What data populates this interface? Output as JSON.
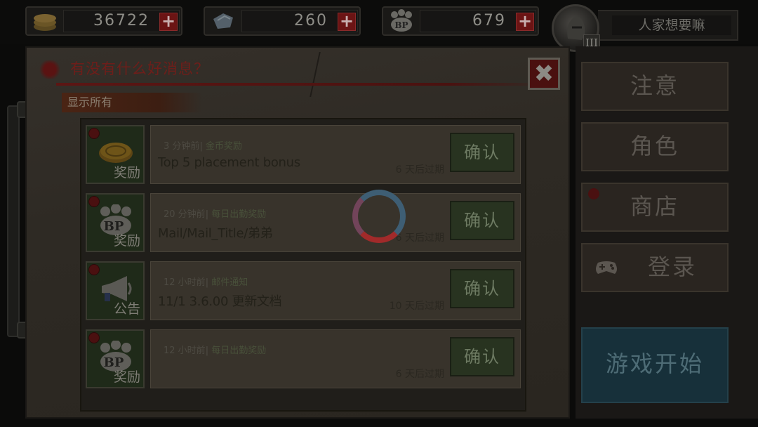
{
  "currency": [
    {
      "icon": "gold-coin-icon",
      "value": "36722"
    },
    {
      "icon": "diamond-icon",
      "value": "260"
    },
    {
      "icon": "bp-paw-icon",
      "value": "679"
    }
  ],
  "player": {
    "rank": "III",
    "nickname": "人家想要嘛"
  },
  "panel": {
    "title": "有没有什么好消息？",
    "filter_label": "显示所有",
    "close_icon": "✖"
  },
  "messages": [
    {
      "time": "3 分钟前",
      "type": "金币奖励",
      "subject": "Top 5 placement bonus",
      "expire": "6 天后过期",
      "tag": "奖励",
      "icon": "coin-icon",
      "confirm": "确认"
    },
    {
      "time": "20 分钟前",
      "type": "每日出勤奖励",
      "subject": "Mail/Mail_Title/弟弟",
      "expire": "6 天后过期",
      "tag": "奖励",
      "icon": "bp-paw-icon",
      "confirm": "确认"
    },
    {
      "time": "12 小时前",
      "type": "邮件通知",
      "subject": "11/1 3.6.00 更新文档",
      "expire": "10 天后过期",
      "tag": "公告",
      "icon": "megaphone-icon",
      "confirm": "确认"
    },
    {
      "time": "12 小时前",
      "type": "每日出勤奖励",
      "subject": "",
      "expire": "6 天后过期",
      "tag": "奖励",
      "icon": "bp-paw-icon",
      "confirm": "确认"
    }
  ],
  "side_menu": {
    "notice": "注意",
    "character": "角色",
    "shop": "商店",
    "login": "登录",
    "start": "游戏开始"
  },
  "colors": {
    "accent_red": "#6e1e1a",
    "confirm_green": "#283320",
    "start_blue": "#17303a"
  }
}
